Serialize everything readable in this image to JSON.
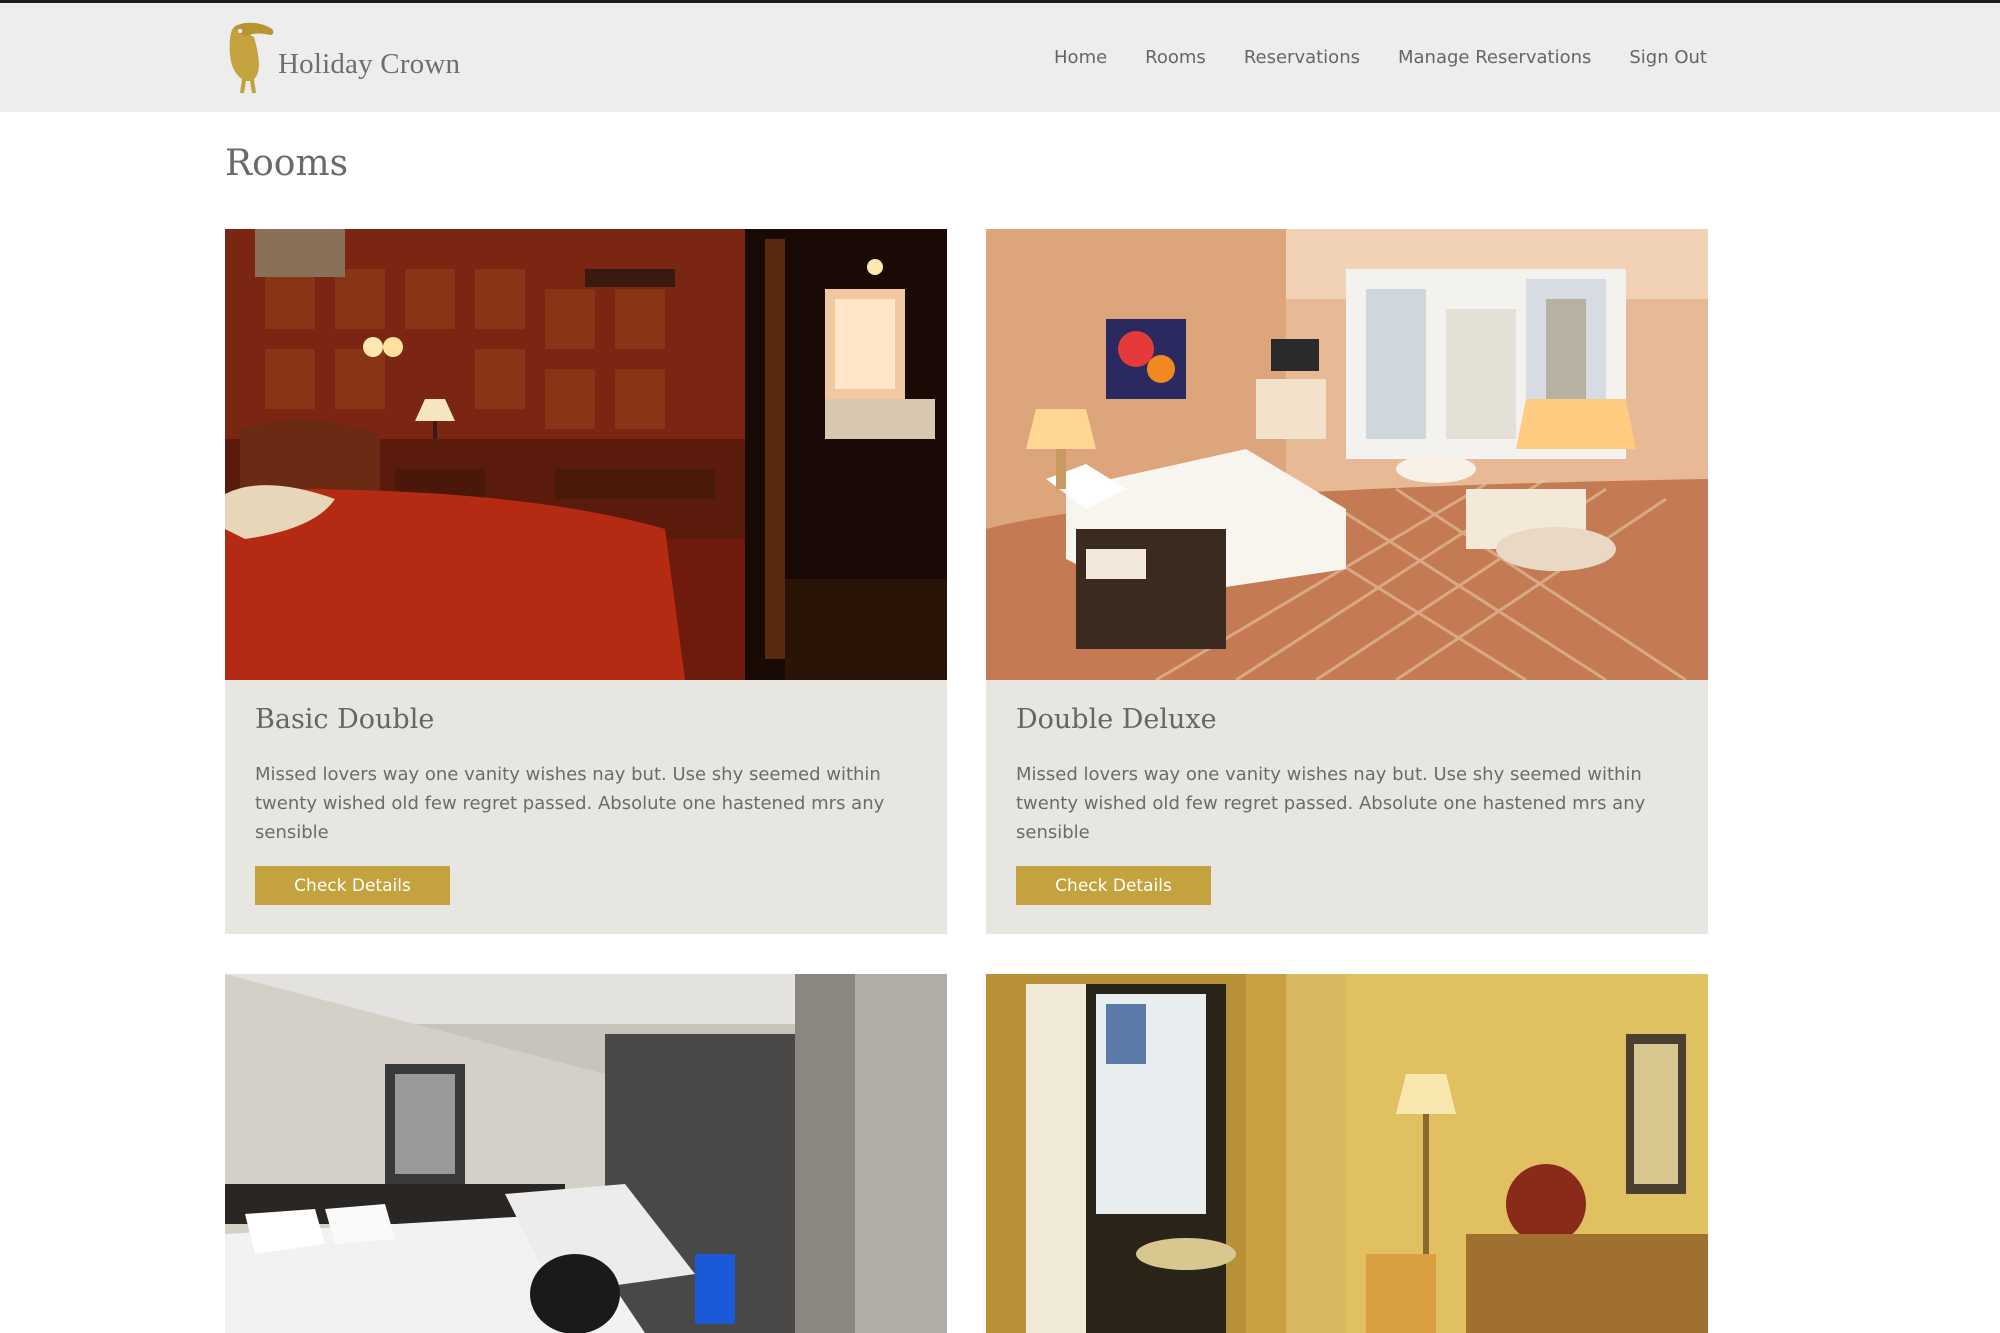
{
  "header": {
    "brand": "Holiday Crown",
    "nav": [
      "Home",
      "Rooms",
      "Reservations",
      "Manage Reservations",
      "Sign Out"
    ]
  },
  "page": {
    "title": "Rooms"
  },
  "rooms": [
    {
      "name": "Basic Double",
      "description": "Missed lovers way one vanity wishes nay but. Use shy seemed within twenty wished old few regret passed. Absolute one hastened mrs any sensible",
      "button": "Check Details"
    },
    {
      "name": "Double Deluxe",
      "description": "Missed lovers way one vanity wishes nay but. Use shy seemed within twenty wished old few regret passed. Absolute one hastened mrs any sensible",
      "button": "Check Details"
    }
  ],
  "colors": {
    "accent": "#c4a33f",
    "header_bg": "#ededed",
    "card_bg": "#e8e6e1"
  },
  "icons": {
    "logo": "toucan-icon"
  }
}
